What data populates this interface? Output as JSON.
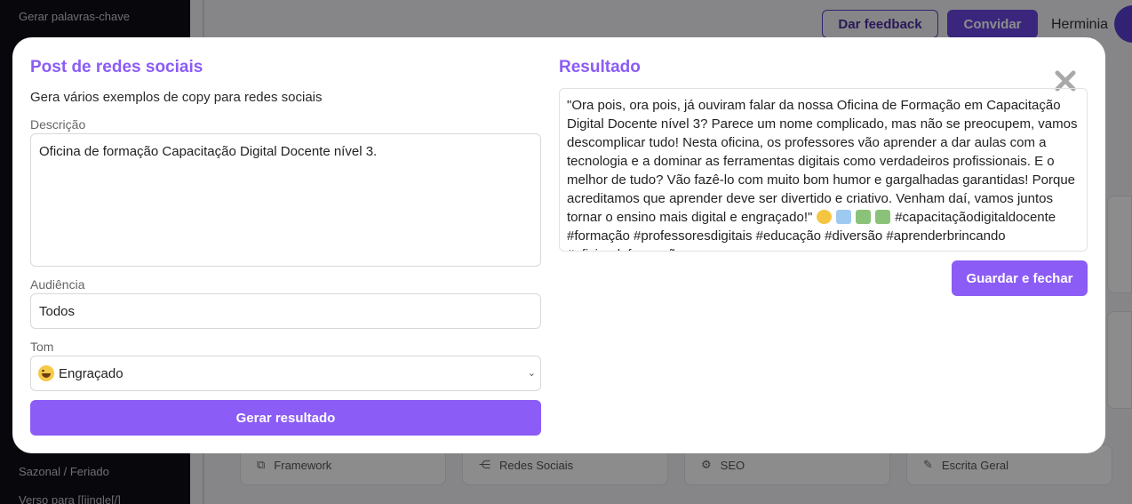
{
  "sidebar": {
    "items": [
      {
        "label": "Gerar palavras-chave"
      },
      {
        "label": "Sazonal / Feriado"
      },
      {
        "label": "Verso para [[jingle[/]"
      }
    ]
  },
  "topbar": {
    "feedback_label": "Dar feedback",
    "invite_label": "Convidar",
    "username": "Herminia"
  },
  "background_cards": [
    {
      "label": "Framework",
      "icon": "framework-icon"
    },
    {
      "label": "Redes Sociais",
      "icon": "share-icon"
    },
    {
      "label": "SEO",
      "icon": "gears-icon"
    },
    {
      "label": "Escrita Geral",
      "icon": "pen-icon"
    }
  ],
  "modal": {
    "title": "Post de redes sociais",
    "subtitle": "Gera vários exemplos de copy para redes sociais",
    "description": {
      "label": "Descrição",
      "value": "Oficina de formação Capacitação Digital Docente nível 3."
    },
    "audience": {
      "label": "Audiência",
      "value": "Todos"
    },
    "tone": {
      "label": "Tom",
      "value": "Engraçado",
      "emoji": "grinning-face"
    },
    "generate_label": "Gerar resultado",
    "result": {
      "title": "Resultado",
      "text": "\"Ora pois, ora pois, já ouviram falar da nossa Oficina de Formação em Capacitação Digital Docente nível 3? Parece um nome complicado, mas não se preocupem, vamos descomplicar tudo! Nesta oficina, os professores vão aprender a dar aulas com a tecnologia e a dominar as ferramentas digitais como verdadeiros profissionais. E o melhor de tudo? Vão fazê-lo com muito bom humor e gargalhadas garantidas! Porque acreditamos que aprender deve ser divertido e criativo. Venham daí, vamos juntos tornar o ensino mais digital e engraçado!\"",
      "emojis": [
        "tongue-face",
        "rocket",
        "teacher",
        "teacher"
      ],
      "hashtags": "#capacitaçãodigitaldocente #formação #professoresdigitais #educação #diversão #aprenderbrincando #oficinadeformação"
    },
    "save_label": "Guardar e fechar"
  },
  "colors": {
    "accent": "#8b5cf6",
    "sidebar": "#0d0d16",
    "invite": "#6b46e4"
  }
}
